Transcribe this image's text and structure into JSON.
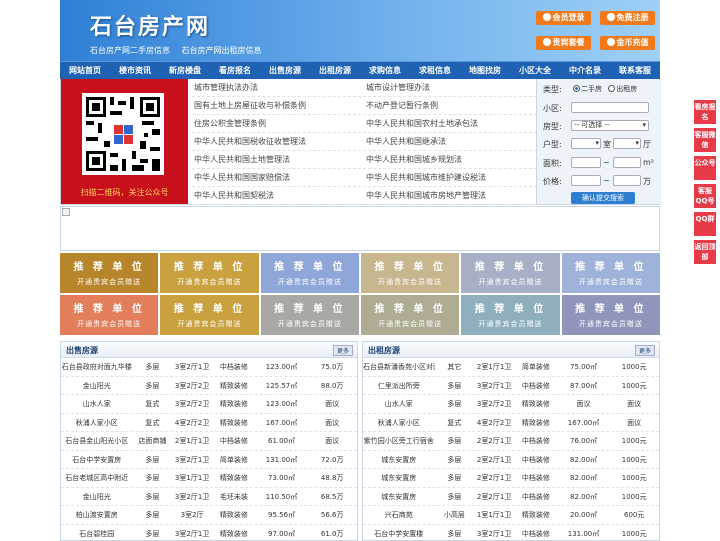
{
  "site": {
    "logo": "石台房产网",
    "slogans": [
      "石台房产网二手房信息",
      "石台房产网出租房信息"
    ],
    "buttons": [
      "会员登录",
      "免费注册",
      "贵宾套餐",
      "金币充值"
    ]
  },
  "nav": [
    "网站首页",
    "楼市资讯",
    "新房楼盘",
    "看房报名",
    "出售房源",
    "出租房源",
    "求购信息",
    "求租信息",
    "地图找房",
    "小区大全",
    "中介名录",
    "联系客服"
  ],
  "qr": {
    "caption": "扫描二维码，关注公众号"
  },
  "links": [
    [
      "城市管理执法办法",
      "城市设计管理办法"
    ],
    [
      "国有土地上房屋征收与补偿条例",
      "不动产登记暂行条例"
    ],
    [
      "住房公积金管理条例",
      "中华人民共和国农村土地承包法"
    ],
    [
      "中华人民共和国税收征收管理法",
      "中华人民共和国继承法"
    ],
    [
      "中华人民共和国土地管理法",
      "中华人民共和国城乡规划法"
    ],
    [
      "中华人民共和国国家赔偿法",
      "中华人民共和国城市维护建设税法"
    ],
    [
      "中华人民共和国契税法",
      "中华人民共和国城市房地产管理法"
    ]
  ],
  "search": {
    "type_label": "类型:",
    "type_options": [
      "二手房",
      "出租房"
    ],
    "community_label": "小区:",
    "housetype_label": "房型:",
    "housetype_value": "-- 可选择 --",
    "layout_label": "户型:",
    "room_unit": "室",
    "hall_unit": "厅",
    "area_label": "面积:",
    "area_unit": "m²",
    "price_label": "价格:",
    "price_unit": "万",
    "range_sep": "~",
    "submit": "确认提交搜索"
  },
  "ads": {
    "title": "推 荐 单 位",
    "subtitle": "开通贵宾会员赠送",
    "colors": [
      "#b8862a",
      "#c9a13e",
      "#8fa6d8",
      "#c8b68e",
      "#a8b0c8",
      "#9eb2da",
      "#e27e5c",
      "#c9a13e",
      "#aaa8a4",
      "#b0ac94",
      "#8eb0be",
      "#8f95bb"
    ]
  },
  "sale": {
    "title": "出售房源",
    "more": "更多",
    "rows": [
      [
        "石台县政府对面九华楼",
        "多层",
        "3室2厅1卫",
        "中档装修",
        "123.00㎡",
        "75.0万"
      ],
      [
        "金山阳光",
        "多层",
        "3室2厅2卫",
        "精致装修",
        "125.57㎡",
        "88.0万"
      ],
      [
        "山水人家",
        "复式",
        "3室2厅2卫",
        "精致装修",
        "123.00㎡",
        "面议"
      ],
      [
        "秋浦人家小区",
        "复式",
        "4室2厅2卫",
        "精致装修",
        "167.00㎡",
        "面议"
      ],
      [
        "石台县金山阳光小区",
        "店面商铺",
        "2室1厅1卫",
        "中档装修",
        "61.00㎡",
        "面议"
      ],
      [
        "石台中学安置房",
        "多层",
        "3室2厅1卫",
        "简单装修",
        "131.00㎡",
        "72.0万"
      ],
      [
        "石台老城区高中附近",
        "多层",
        "3室1厅1卫",
        "精致装修",
        "73.00㎡",
        "48.8万"
      ],
      [
        "金山阳光",
        "多层",
        "3室2厅1卫",
        "毛坯未装",
        "110.50㎡",
        "68.5万"
      ],
      [
        "柏山渡安置房",
        "多层",
        "3室2厅",
        "精致装修",
        "95.56㎡",
        "56.6万"
      ],
      [
        "石台碧桂园",
        "多层",
        "3室2厅1卫",
        "精致装修",
        "97.00㎡",
        "61.0万"
      ]
    ]
  },
  "rent": {
    "title": "出租房源",
    "more": "更多",
    "rows": [
      [
        "石台县新潘香苑小区对面",
        "其它",
        "2室1厅1卫",
        "简单装修",
        "75.00㎡",
        "1000元"
      ],
      [
        "仁里派出所旁",
        "多层",
        "3室2厅1卫",
        "中档装修",
        "87.00㎡",
        "1000元"
      ],
      [
        "山水人家",
        "多层",
        "3室2厅2卫",
        "精致装修",
        "面议",
        "面议"
      ],
      [
        "秋浦人家小区",
        "复式",
        "4室2厅2卫",
        "精致装修",
        "167.00㎡",
        "面议"
      ],
      [
        "紫竹园小区旁工行宿舍",
        "多层",
        "2室2厅1卫",
        "中档装修",
        "76.00㎡",
        "1000元"
      ],
      [
        "城东安置房",
        "多层",
        "2室2厅1卫",
        "中档装修",
        "82.00㎡",
        "1000元"
      ],
      [
        "城东安置房",
        "多层",
        "2室2厅1卫",
        "中档装修",
        "82.00㎡",
        "1000元"
      ],
      [
        "城东安置房",
        "多层",
        "2室2厅1卫",
        "中档装修",
        "82.00㎡",
        "1000元"
      ],
      [
        "兴石商苑",
        "小高层",
        "1室1厅1卫",
        "精致装修",
        "20.00㎡",
        "600元"
      ],
      [
        "石台中学安置楼",
        "多层",
        "3室2厅1卫",
        "中档装修",
        "131.00㎡",
        "1000元"
      ]
    ]
  },
  "side": [
    "看房报名",
    "客服微信",
    "公众号",
    "客服QQ号",
    "QQ群",
    "返回顶部"
  ]
}
